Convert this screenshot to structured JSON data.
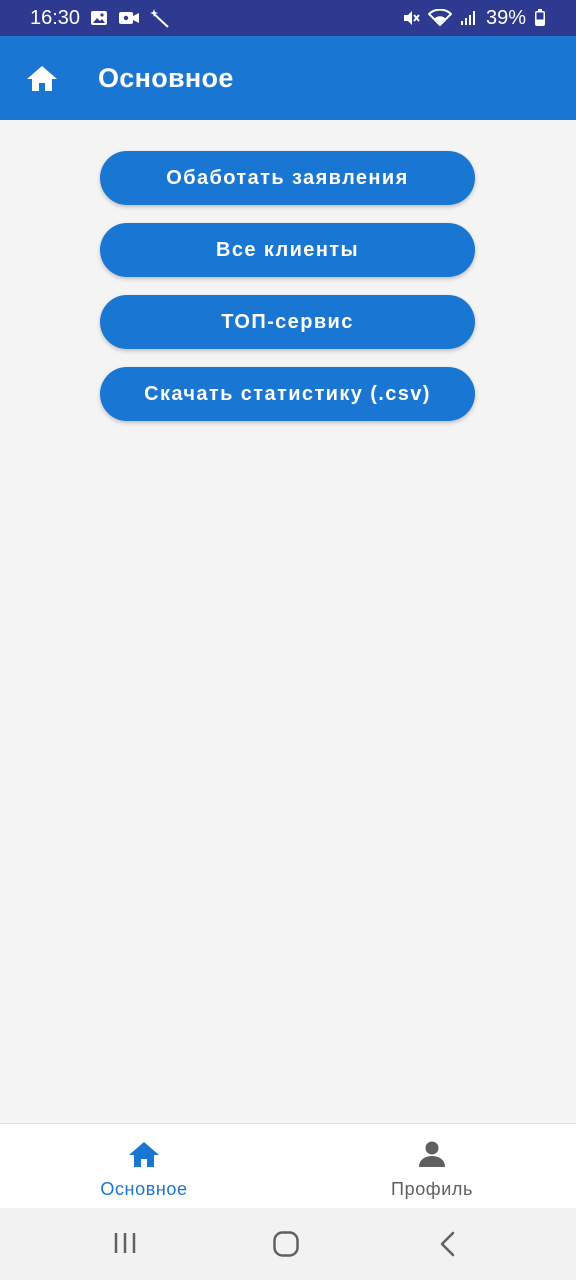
{
  "status_bar": {
    "time": "16:30",
    "battery": "39%"
  },
  "app_bar": {
    "title": "Основное",
    "icon": "home-icon"
  },
  "actions": [
    {
      "label": "Обаботать заявления"
    },
    {
      "label": "Все клиенты"
    },
    {
      "label": "ТОП-сервис"
    },
    {
      "label": "Скачать статистику (.csv)"
    }
  ],
  "bottom_nav": {
    "items": [
      {
        "label": "Основное",
        "icon": "home-icon",
        "active": true
      },
      {
        "label": "Профиль",
        "icon": "person-icon",
        "active": false
      }
    ]
  },
  "colors": {
    "primary": "#1976d2",
    "status_bar": "#2d3a8f",
    "background": "#f4f4f5"
  }
}
